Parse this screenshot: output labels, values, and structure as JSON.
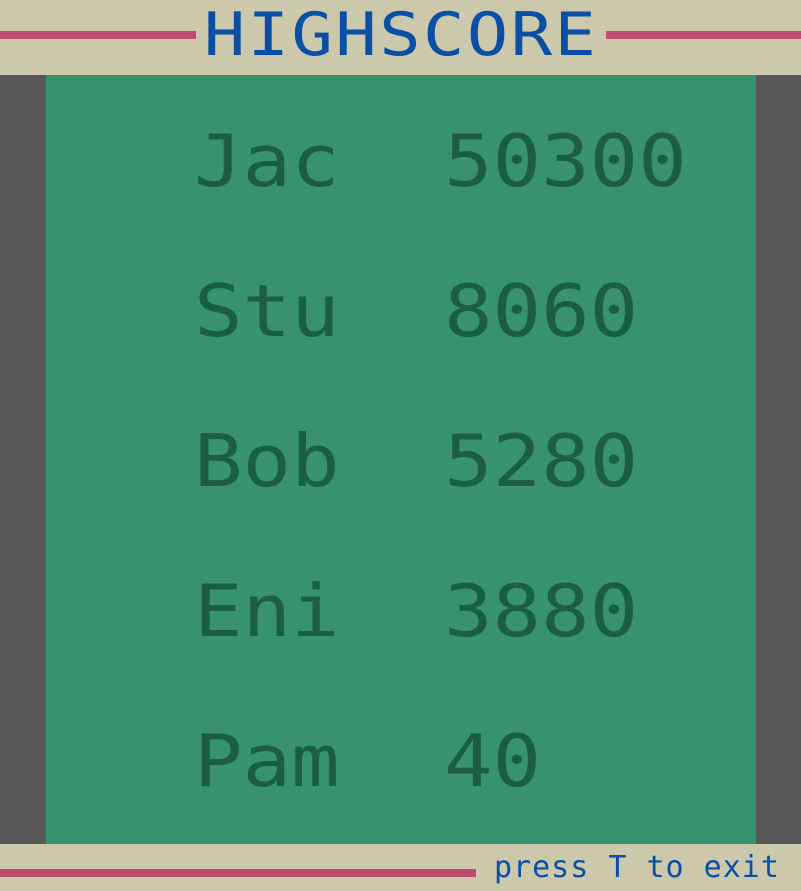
{
  "header": {
    "title": "HIGHSCORE"
  },
  "scores": [
    {
      "name": "Jac",
      "score": "50300"
    },
    {
      "name": "Stu",
      "score": "8060"
    },
    {
      "name": "Bob",
      "score": "5280"
    },
    {
      "name": "Eni",
      "score": "3880"
    },
    {
      "name": "Pam",
      "score": "40"
    }
  ],
  "footer": {
    "hint": "press T to exit"
  },
  "colors": {
    "background": "#cbc8ac",
    "board": "#37926d",
    "side_panel": "#585858",
    "accent_line": "#c14a75",
    "title_text": "#0a4fa6",
    "score_text": "#1b5e44"
  }
}
